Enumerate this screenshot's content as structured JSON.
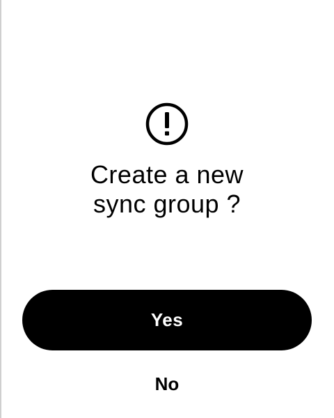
{
  "dialog": {
    "icon": "exclamation-circle-icon",
    "title_line1": "Create a new",
    "title_line2": "sync group ?",
    "confirm_label": "Yes",
    "cancel_label": "No"
  },
  "colors": {
    "background": "#ffffff",
    "primary_button": "#000000",
    "primary_button_text": "#ffffff",
    "text": "#000000"
  }
}
